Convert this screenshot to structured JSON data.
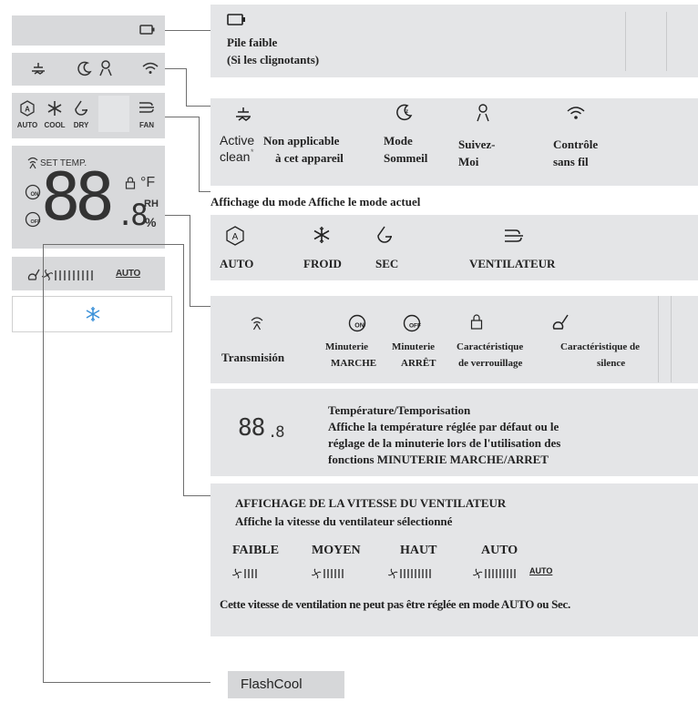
{
  "lcd": {
    "set_temp_label": "SET TEMP.",
    "mode_labels": [
      "AUTO",
      "COOL",
      "DRY",
      "FAN"
    ],
    "fahrenheit": "°F",
    "rh": "RH",
    "percent": "%",
    "digits": "88",
    "decimal": ".8",
    "auto_badge": "AUTO"
  },
  "battery": {
    "line1": "Pile faible",
    "line2": "(Si les clignotants)"
  },
  "functions": {
    "items": [
      {
        "icon": "active-clean-icon",
        "l1": "Active",
        "l2": "clean"
      },
      {
        "icon": "",
        "l1": "Non applicable",
        "l2": "à cet appareil"
      },
      {
        "icon": "sleep-mode-icon",
        "l1": "Mode",
        "l2": "Sommeil"
      },
      {
        "icon": "follow-me-icon",
        "l1": "Suivez-",
        "l2": "Moi"
      },
      {
        "icon": "wireless-icon",
        "l1": "Contrôle",
        "l2": "sans fil"
      }
    ]
  },
  "mode_section": {
    "heading": "Affichage du mode Affiche le mode actuel",
    "items": [
      "AUTO",
      "FROID",
      "SEC",
      "VENTILATEUR"
    ]
  },
  "indicators": {
    "items": [
      {
        "l1": "Transmisión",
        "l2": ""
      },
      {
        "l1": "Minuterie",
        "l2": "MARCHE"
      },
      {
        "l1": "Minuterie",
        "l2": "ARRÊT"
      },
      {
        "l1": "Caractéristique",
        "l2": "de verrouillage"
      },
      {
        "l1": "Caractéristique de",
        "l2": "silence"
      }
    ]
  },
  "temperature": {
    "digits": "88",
    "decimal": ".8",
    "title": "Température/Temporisation",
    "desc1": "Affiche la température réglée par défaut ou le",
    "desc2": "réglage de la minuterie lors de l'utilisation des",
    "desc3": "fonctions MINUTERIE MARCHE/ARRET"
  },
  "fan_speed": {
    "title": "AFFICHAGE DE LA VITESSE DU VENTILATEUR",
    "subtitle": "Affiche la vitesse du ventilateur sélectionné",
    "levels": [
      {
        "label": "FAIBLE",
        "bars": 4
      },
      {
        "label": "MOYEN",
        "bars": 6
      },
      {
        "label": "HAUT",
        "bars": 9
      },
      {
        "label": "AUTO",
        "bars": 9
      }
    ],
    "auto_badge": "AUTO",
    "note": "Cette vitesse de ventilation ne peut pas être réglée en mode AUTO ou Sec."
  },
  "flashcool": {
    "label": "FlashCool"
  }
}
